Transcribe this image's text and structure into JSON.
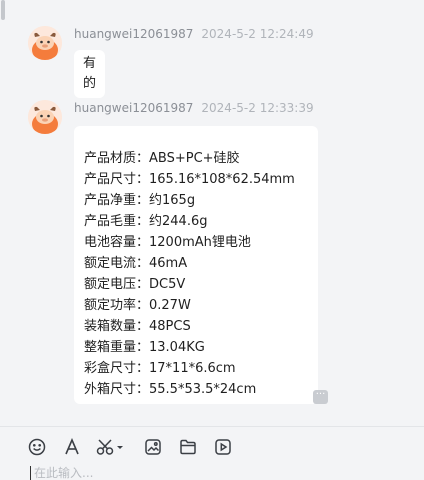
{
  "messages": [
    {
      "sender": "huangwei12061987",
      "time": "2024-5-2 12:24:49",
      "text": "有的"
    },
    {
      "sender": "huangwei12061987",
      "time": "2024-5-2 12:33:39",
      "lines": [
        "产品材质：ABS+PC+硅胶",
        "产品尺寸：165.16*108*62.54mm",
        "产品净重：约165g",
        "产品毛重：约244.6g",
        "电池容量：1200mAh锂电池",
        "额定电流：46mA",
        "额定电压：DC5V",
        "额定功率：0.27W",
        "装箱数量：48PCS",
        "整箱重量：13.04KG",
        "彩盒尺寸：17*11*6.6cm",
        "外箱尺寸：55.5*53.5*24cm"
      ]
    }
  ],
  "more_button": {
    "glyph": "···"
  },
  "toolbar": {
    "icons": [
      "emoji-icon",
      "font-icon",
      "scissors-icon",
      "image-icon",
      "folder-icon",
      "video-icon"
    ]
  },
  "input": {
    "placeholder": "在此输入..."
  },
  "colors": {
    "background": "#f3f4f6",
    "bubble": "#ffffff",
    "avatar": "#f47c3c"
  }
}
